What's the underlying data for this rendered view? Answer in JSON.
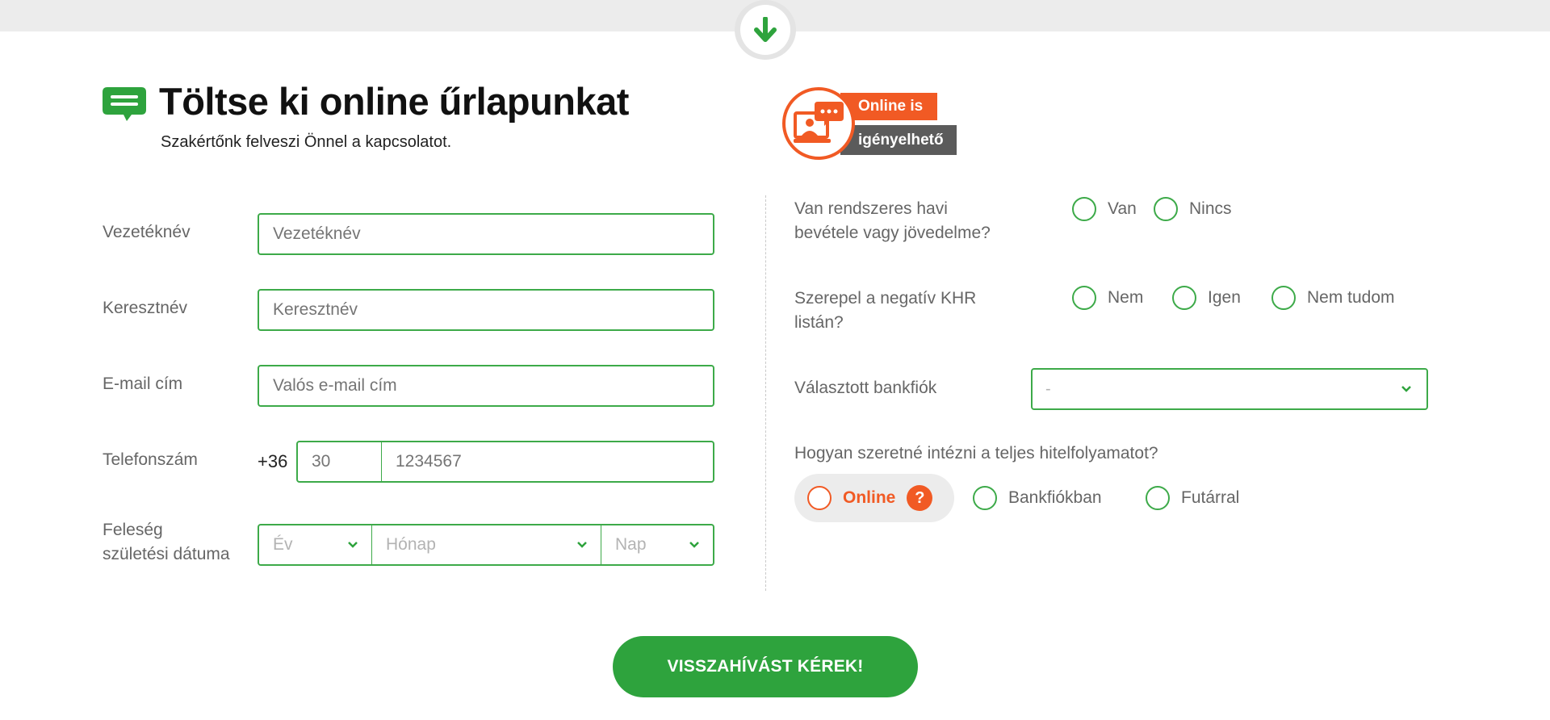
{
  "header": {
    "title": "Töltse ki online űrlapunkat",
    "subtitle": "Szakértőnk felveszi Önnel a kapcsolatot."
  },
  "badge": {
    "line1": "Online is",
    "line2": "igényelhető"
  },
  "form_left": {
    "last_name": {
      "label": "Vezetéknév",
      "placeholder": "Vezetéknév"
    },
    "first_name": {
      "label": "Keresztnév",
      "placeholder": "Keresztnév"
    },
    "email": {
      "label": "E-mail cím",
      "placeholder": "Valós e-mail cím"
    },
    "phone": {
      "label": "Telefonszám",
      "prefix": "+36",
      "area_placeholder": "30",
      "number_placeholder": "1234567"
    },
    "spouse_birth": {
      "label_line1": "Feleség",
      "label_line2": "születési dátuma",
      "year": "Év",
      "month": "Hónap",
      "day": "Nap"
    }
  },
  "form_right": {
    "income": {
      "question_line1": "Van rendszeres havi",
      "question_line2": "bevétele vagy jövedelme?",
      "options": [
        "Van",
        "Nincs"
      ]
    },
    "khr": {
      "question_line1": "Szerepel a negatív KHR",
      "question_line2": "listán?",
      "options": [
        "Nem",
        "Igen",
        "Nem tudom"
      ]
    },
    "branch": {
      "label": "Választott bankfiók",
      "value": "-"
    },
    "process": {
      "question": "Hogyan szeretné intézni a teljes hitelfolyamatot?",
      "online": "Online",
      "help": "?",
      "options": [
        "Bankfiókban",
        "Futárral"
      ]
    }
  },
  "submit_label": "VISSZAHÍVÁST KÉREK!",
  "colors": {
    "green": "#3daa49",
    "button_green": "#2ea33d",
    "orange": "#f15a24",
    "gray_badge": "#5b5b5b"
  }
}
